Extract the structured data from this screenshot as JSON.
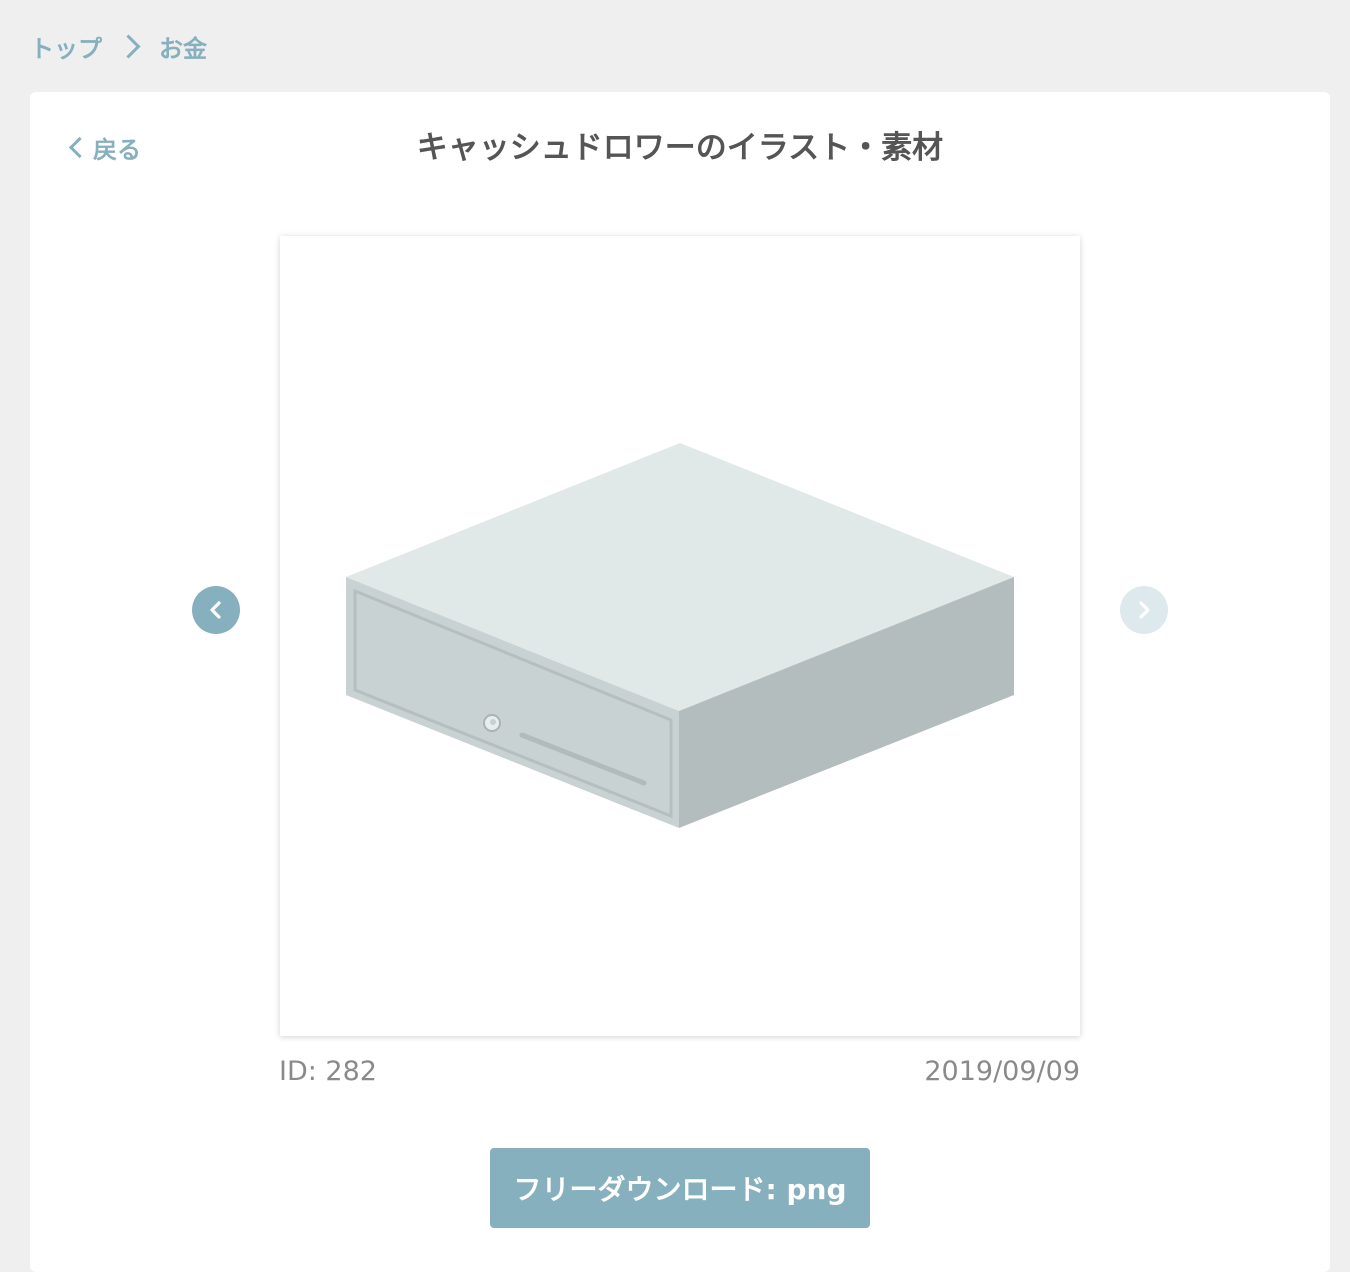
{
  "breadcrumb": {
    "items": [
      "トップ",
      "お金"
    ]
  },
  "page": {
    "back_label": "戻る",
    "title": "キャッシュドロワーのイラスト・素材"
  },
  "illustration": {
    "icon": "cash-drawer-illustration",
    "colors": {
      "top": "#e1e8e8",
      "front": "#c9d2d3",
      "side": "#b4bdbd",
      "outline": "#b6bfbf"
    }
  },
  "meta": {
    "id_text": "ID: 282",
    "date_text": "2019/09/09"
  },
  "download": {
    "label": "フリーダウンロード: png"
  },
  "colors": {
    "accent": "#86b0bd",
    "accent_light": "#dde9ed",
    "background": "#efefef",
    "title_text": "#555555",
    "meta_text": "#8a8a8a"
  }
}
